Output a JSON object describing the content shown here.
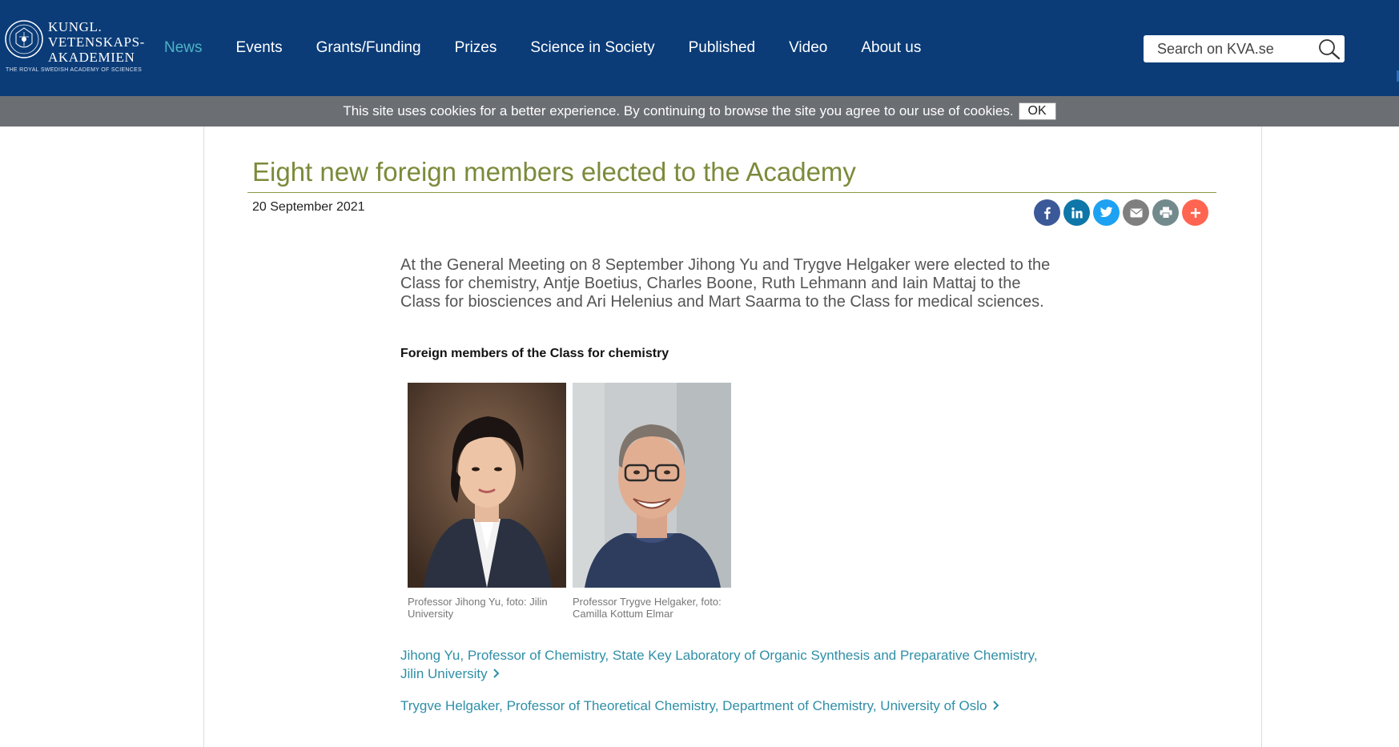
{
  "header": {
    "logo": {
      "line1": "KUNGL.",
      "line2": "VETENSKAPS-",
      "line3": "AKADEMIEN",
      "subtitle": "THE ROYAL SWEDISH ACADEMY OF SCIENCES"
    },
    "nav": [
      {
        "label": "News",
        "active": true
      },
      {
        "label": "Events"
      },
      {
        "label": "Grants/Funding"
      },
      {
        "label": "Prizes"
      },
      {
        "label": "Science in Society"
      },
      {
        "label": "Published"
      },
      {
        "label": "Video"
      },
      {
        "label": "About us"
      }
    ],
    "search": {
      "placeholder": "Search on KVA.se",
      "icon": "search-icon"
    }
  },
  "cookie_bar": {
    "text": "This site uses cookies for a better experience. By continuing to browse the site you agree to our use of cookies.",
    "ok_label": "OK"
  },
  "article": {
    "title": "Eight new foreign members elected to the Academy",
    "date": "20 September 2021",
    "share": [
      {
        "icon": "facebook-icon",
        "color": "#3b5998"
      },
      {
        "icon": "linkedin-icon",
        "color": "#0e76a8"
      },
      {
        "icon": "twitter-icon",
        "color": "#1da1f2"
      },
      {
        "icon": "email-icon",
        "color": "#7f7f7f"
      },
      {
        "icon": "print-icon",
        "color": "#738a8d"
      },
      {
        "icon": "plus-icon",
        "color": "#ff6550"
      }
    ],
    "lead": "At the General Meeting on 8 September Jihong Yu and Trygve Helgaker were elected to the Class for chemistry, Antje Boetius, Charles Boone, Ruth Lehmann and Iain Mattaj to the Class for biosciences and Ari Helenius and Mart Saarma to the Class for medical sciences.",
    "section_heading": "Foreign members of the Class for chemistry",
    "photos": [
      {
        "caption": "Professor Jihong Yu, foto: Jilin University"
      },
      {
        "caption": "Professor Trygve Helgaker, foto: Camilla Kottum Elmar"
      }
    ],
    "links": [
      "Jihong Yu, Professor of Chemistry, State Key Laboratory of Organic Synthesis and Preparative Chemistry, Jilin University",
      "Trygve Helgaker, Professor of Theoretical Chemistry, Department of Chemistry, University of Oslo"
    ]
  }
}
